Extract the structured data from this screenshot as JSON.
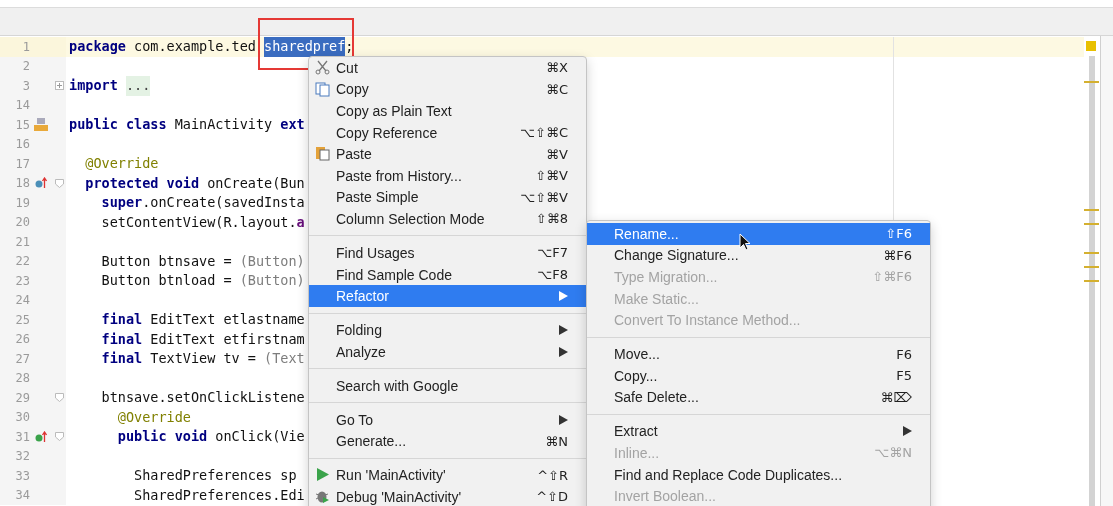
{
  "editor": {
    "lines": [
      {
        "number": "1",
        "current": true,
        "tokens": [
          {
            "kind": "keyword",
            "text": "package"
          },
          {
            "kind": "plain",
            "text": " com.example.ted "
          },
          {
            "kind": "selected",
            "text": "sharedpref"
          },
          {
            "kind": "plain",
            "text": ";"
          }
        ]
      },
      {
        "number": "2",
        "current": false
      },
      {
        "number": "3",
        "current": false,
        "fold": {
          "collapsed": true
        },
        "tokens": [
          {
            "kind": "keyword",
            "text": "import"
          },
          {
            "kind": "folded",
            "text": "..."
          }
        ]
      },
      {
        "number": "14",
        "current": false
      },
      {
        "number": "15",
        "current": false,
        "marker": {
          "kind": "class"
        },
        "tokens": [
          {
            "kind": "keyword",
            "text": "public class"
          },
          {
            "kind": "plain",
            "text": " MainActivity "
          },
          {
            "kind": "keyword",
            "text": "ext"
          }
        ]
      },
      {
        "number": "16",
        "current": false
      },
      {
        "number": "17",
        "current": false,
        "tokens": [
          {
            "kind": "annotation",
            "text": "  @Override"
          }
        ]
      },
      {
        "number": "18",
        "current": false,
        "marker": {
          "kind": "override",
          "color": "#4b8fb8"
        },
        "fold": {
          "collapsed": false
        },
        "tokens": [
          {
            "kind": "keyword",
            "text": "  protected void"
          },
          {
            "kind": "plain",
            "text": " onCreate(Bun"
          }
        ]
      },
      {
        "number": "19",
        "current": false,
        "tokens": [
          {
            "kind": "keyword",
            "text": "    super"
          },
          {
            "kind": "plain",
            "text": ".onCreate(savedInsta"
          }
        ]
      },
      {
        "number": "20",
        "current": false,
        "tokens": [
          {
            "kind": "plain",
            "text": "    setContentView(R.layout."
          },
          {
            "kind": "field",
            "text": "a"
          }
        ]
      },
      {
        "number": "21",
        "current": false
      },
      {
        "number": "22",
        "current": false,
        "tokens": [
          {
            "kind": "plain",
            "text": "    Button btnsave = "
          },
          {
            "kind": "dim",
            "text": "(Button)"
          }
        ]
      },
      {
        "number": "23",
        "current": false,
        "tokens": [
          {
            "kind": "plain",
            "text": "    Button btnload = "
          },
          {
            "kind": "dim",
            "text": "(Button)"
          }
        ]
      },
      {
        "number": "24",
        "current": false
      },
      {
        "number": "25",
        "current": false,
        "tokens": [
          {
            "kind": "keyword",
            "text": "    final"
          },
          {
            "kind": "plain",
            "text": " EditText etlastname"
          }
        ]
      },
      {
        "number": "26",
        "current": false,
        "tokens": [
          {
            "kind": "keyword",
            "text": "    final"
          },
          {
            "kind": "plain",
            "text": " EditText etfirstnam"
          }
        ]
      },
      {
        "number": "27",
        "current": false,
        "tokens": [
          {
            "kind": "keyword",
            "text": "    final"
          },
          {
            "kind": "plain",
            "text": " TextView tv = "
          },
          {
            "kind": "dim",
            "text": "(Text"
          }
        ]
      },
      {
        "number": "28",
        "current": false
      },
      {
        "number": "29",
        "current": false,
        "fold": {
          "collapsed": false
        },
        "tokens": [
          {
            "kind": "plain",
            "text": "    btnsave.setOnClickListene"
          }
        ]
      },
      {
        "number": "30",
        "current": false,
        "tokens": [
          {
            "kind": "annotation",
            "text": "      @Override"
          }
        ]
      },
      {
        "number": "31",
        "current": false,
        "marker": {
          "kind": "override",
          "color": "#3aa34a"
        },
        "fold": {
          "collapsed": false
        },
        "tokens": [
          {
            "kind": "keyword",
            "text": "      public void"
          },
          {
            "kind": "plain",
            "text": " onClick(Vie"
          }
        ]
      },
      {
        "number": "32",
        "current": false
      },
      {
        "number": "33",
        "current": false,
        "tokens": [
          {
            "kind": "plain",
            "text": "        SharedPreferences sp"
          }
        ]
      },
      {
        "number": "34",
        "current": false,
        "tokens": [
          {
            "kind": "plain",
            "text": "        SharedPreferences.Edi"
          }
        ]
      }
    ]
  },
  "context_menu": {
    "items": [
      {
        "kind": "item",
        "label": "Cut",
        "shortcut": "⌘X",
        "selected": false,
        "disabled": false,
        "has_submenu": false
      },
      {
        "kind": "item",
        "label": "Copy",
        "shortcut": "⌘C",
        "selected": false,
        "disabled": false,
        "has_submenu": false
      },
      {
        "kind": "item",
        "label": "Copy as Plain Text",
        "selected": false,
        "disabled": false,
        "has_submenu": false
      },
      {
        "kind": "item",
        "label": "Copy Reference",
        "shortcut": "⌥⇧⌘C",
        "selected": false,
        "disabled": false,
        "has_submenu": false
      },
      {
        "kind": "item",
        "label": "Paste",
        "shortcut": "⌘V",
        "selected": false,
        "disabled": false,
        "has_submenu": false
      },
      {
        "kind": "item",
        "label": "Paste from History...",
        "shortcut": "⇧⌘V",
        "selected": false,
        "disabled": false,
        "has_submenu": false
      },
      {
        "kind": "item",
        "label": "Paste Simple",
        "shortcut": "⌥⇧⌘V",
        "selected": false,
        "disabled": false,
        "has_submenu": false
      },
      {
        "kind": "item",
        "label": "Column Selection Mode",
        "shortcut": "⇧⌘8",
        "selected": false,
        "disabled": false,
        "has_submenu": false
      },
      {
        "kind": "separator"
      },
      {
        "kind": "item",
        "label": "Find Usages",
        "shortcut": "⌥F7",
        "selected": false,
        "disabled": false,
        "has_submenu": false
      },
      {
        "kind": "item",
        "label": "Find Sample Code",
        "shortcut": "⌥F8",
        "selected": false,
        "disabled": false,
        "has_submenu": false
      },
      {
        "kind": "item",
        "label": "Refactor",
        "selected": true,
        "disabled": false,
        "has_submenu": true
      },
      {
        "kind": "separator"
      },
      {
        "kind": "item",
        "label": "Folding",
        "selected": false,
        "disabled": false,
        "has_submenu": true
      },
      {
        "kind": "item",
        "label": "Analyze",
        "selected": false,
        "disabled": false,
        "has_submenu": true
      },
      {
        "kind": "separator"
      },
      {
        "kind": "item",
        "label": "Search with Google",
        "selected": false,
        "disabled": false,
        "has_submenu": false
      },
      {
        "kind": "separator"
      },
      {
        "kind": "item",
        "label": "Go To",
        "selected": false,
        "disabled": false,
        "has_submenu": true
      },
      {
        "kind": "item",
        "label": "Generate...",
        "shortcut": "⌘N",
        "selected": false,
        "disabled": false,
        "has_submenu": false
      },
      {
        "kind": "separator"
      },
      {
        "kind": "item",
        "label": "Run 'MainActivity'",
        "shortcut": "^⇧R",
        "selected": false,
        "disabled": false,
        "has_submenu": false
      },
      {
        "kind": "item",
        "label": "Debug 'MainActivity'",
        "shortcut": "^⇧D",
        "selected": false,
        "disabled": false,
        "has_submenu": false
      }
    ]
  },
  "refactor_submenu": {
    "items": [
      {
        "kind": "item",
        "label": "Rename...",
        "shortcut": "⇧F6",
        "selected": true,
        "disabled": false,
        "has_submenu": false
      },
      {
        "kind": "item",
        "label": "Change Signature...",
        "shortcut": "⌘F6",
        "selected": false,
        "disabled": false,
        "has_submenu": false
      },
      {
        "kind": "item",
        "label": "Type Migration...",
        "shortcut": "⇧⌘F6",
        "selected": false,
        "disabled": true,
        "has_submenu": false
      },
      {
        "kind": "item",
        "label": "Make Static...",
        "selected": false,
        "disabled": true,
        "has_submenu": false
      },
      {
        "kind": "item",
        "label": "Convert To Instance Method...",
        "selected": false,
        "disabled": true,
        "has_submenu": false
      },
      {
        "kind": "separator"
      },
      {
        "kind": "item",
        "label": "Move...",
        "shortcut": "F6",
        "selected": false,
        "disabled": false,
        "has_submenu": false
      },
      {
        "kind": "item",
        "label": "Copy...",
        "shortcut": "F5",
        "selected": false,
        "disabled": false,
        "has_submenu": false
      },
      {
        "kind": "item",
        "label": "Safe Delete...",
        "shortcut": "⌘⌦",
        "selected": false,
        "disabled": false,
        "has_submenu": false
      },
      {
        "kind": "separator"
      },
      {
        "kind": "item",
        "label": "Extract",
        "selected": false,
        "disabled": false,
        "has_submenu": true
      },
      {
        "kind": "item",
        "label": "Inline...",
        "shortcut": "⌥⌘N",
        "selected": false,
        "disabled": true,
        "has_submenu": false
      },
      {
        "kind": "item",
        "label": "Find and Replace Code Duplicates...",
        "selected": false,
        "disabled": false,
        "has_submenu": false
      },
      {
        "kind": "item",
        "label": "Invert Boolean...",
        "selected": false,
        "disabled": true,
        "has_submenu": false
      }
    ]
  }
}
